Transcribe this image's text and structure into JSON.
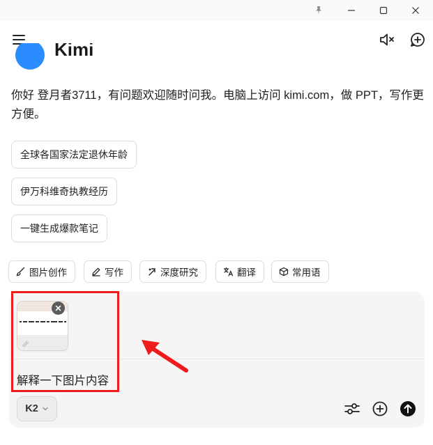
{
  "window": {
    "title": "",
    "pin_icon": "pin-icon",
    "minimize_icon": "minimize-icon",
    "maximize_icon": "maximize-icon",
    "close_icon": "close-icon"
  },
  "header": {
    "menu_icon": "hamburger-menu-icon",
    "mute_icon": "speaker-muted-icon",
    "new_chat_icon": "new-chat-icon"
  },
  "logo": {
    "text": "Kimi",
    "color": "#2a8cff"
  },
  "greeting": "你好 登月者3711，有问题欢迎随时问我。电脑上访问 kimi.com，做 PPT，写作更方便。",
  "suggestions": [
    "全球各国家法定退休年龄",
    "伊万科维奇执教经历",
    "一键生成爆款笔记"
  ],
  "tools": [
    {
      "label": "图片创作",
      "icon": "paint-brush-icon"
    },
    {
      "label": "写作",
      "icon": "pen-icon"
    },
    {
      "label": "深度研究",
      "icon": "deep-research-icon"
    },
    {
      "label": "翻译",
      "icon": "translate-icon"
    },
    {
      "label": "常用语",
      "icon": "cube-icon"
    }
  ],
  "composer": {
    "attachment": {
      "type": "image-thumbnail",
      "remove_icon": "close-icon"
    },
    "input_value": "解释一下图片内容",
    "model_label": "K2",
    "model_dropdown_icon": "chevron-down-icon",
    "settings_icon": "sliders-icon",
    "add_icon": "plus-circle-icon",
    "send_icon": "send-arrow-up-icon"
  },
  "annotation": {
    "box_color": "#ee1c1c",
    "arrow_color": "#ee1c1c"
  }
}
